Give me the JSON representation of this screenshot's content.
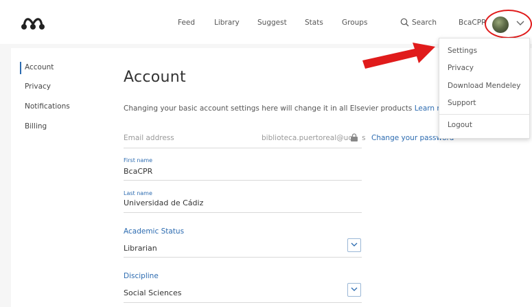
{
  "nav": {
    "items": [
      "Feed",
      "Library",
      "Suggest",
      "Stats",
      "Groups"
    ],
    "search_label": "Search",
    "user_name": "BcaCPR"
  },
  "sidebar": {
    "items": [
      {
        "label": "Account",
        "active": true
      },
      {
        "label": "Privacy",
        "active": false
      },
      {
        "label": "Notifications",
        "active": false
      },
      {
        "label": "Billing",
        "active": false
      }
    ]
  },
  "main": {
    "title": "Account",
    "intro_text": "Changing your basic account settings here will change it in all Elsevier products ",
    "intro_link": "Learn mo",
    "email": {
      "label": "Email address",
      "value": "biblioteca.puertoreal@uc",
      "value_suffix": "s",
      "change_password": "Change your password"
    },
    "first_name": {
      "label": "First name",
      "value": "BcaCPR"
    },
    "last_name": {
      "label": "Last name",
      "value": "Universidad de Cádiz"
    },
    "academic_status": {
      "label": "Academic Status",
      "value": "Librarian"
    },
    "discipline": {
      "label": "Discipline",
      "value": "Social Sciences"
    }
  },
  "dropdown_menu": {
    "items": [
      "Settings",
      "Privacy",
      "Download Mendeley",
      "Support"
    ],
    "logout": "Logout"
  },
  "colors": {
    "accent": "#2c6bb0",
    "annotation": "#e01b1b"
  }
}
